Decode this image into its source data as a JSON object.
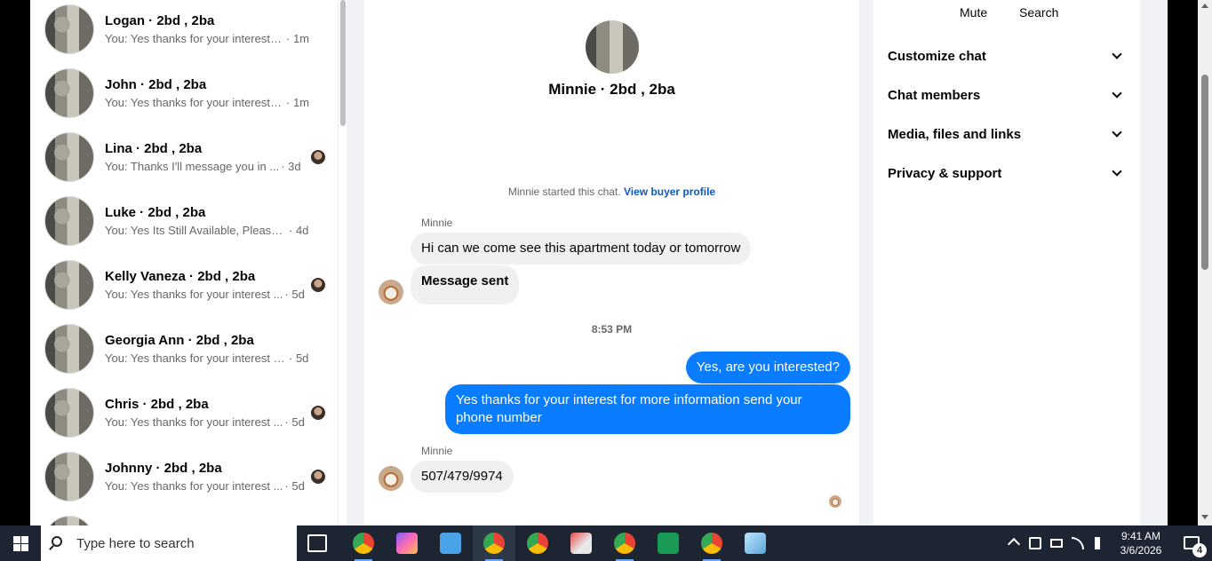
{
  "conversations": [
    {
      "name": "Logan · 2bd , 2ba",
      "preview": "You: Yes thanks for your interest fo...",
      "time": "· 1m",
      "read_avatar": false
    },
    {
      "name": "John · 2bd , 2ba",
      "preview": "You: Yes thanks for your interest fo...",
      "time": "· 1m",
      "read_avatar": false
    },
    {
      "name": "Lina · 2bd , 2ba",
      "preview": "You: Thanks I'll message you in ...",
      "time": "· 3d",
      "read_avatar": true
    },
    {
      "name": "Luke · 2bd , 2ba",
      "preview": "You: Yes Its Still Available, Please Se...",
      "time": "· 4d",
      "read_avatar": false
    },
    {
      "name": "Kelly Vaneza · 2bd , 2ba",
      "preview": "You: Yes thanks for your interest ...",
      "time": "· 5d",
      "read_avatar": true
    },
    {
      "name": "Georgia Ann · 2bd , 2ba",
      "preview": "You: Yes thanks for your interest for...",
      "time": "· 5d",
      "read_avatar": false
    },
    {
      "name": "Chris · 2bd , 2ba",
      "preview": "You: Yes thanks for your interest ...",
      "time": "· 5d",
      "read_avatar": true
    },
    {
      "name": "Johnny · 2bd , 2ba",
      "preview": "You: Yes thanks for your interest ...",
      "time": "· 5d",
      "read_avatar": true
    }
  ],
  "chat": {
    "title": "Minnie · 2bd , 2ba",
    "started_text": "Minnie started this chat.",
    "buyer_link": "View buyer profile",
    "sender_1": "Minnie",
    "msg_1": "Hi can we come see this apartment today or tomorrow",
    "msg_2": "Message sent",
    "timestamp": "8:53 PM",
    "msg_3": "Yes, are you interested?",
    "msg_4": "Yes thanks for your interest for more information send your phone number",
    "sender_2": "Minnie",
    "msg_5": "507/479/9974"
  },
  "info": {
    "mute": "Mute",
    "search": "Search",
    "sections": [
      "Customize chat",
      "Chat members",
      "Media, files and links",
      "Privacy & support"
    ]
  },
  "taskbar": {
    "search_placeholder": "Type here to search",
    "time": "9:41 AM",
    "date": "3/6/2026",
    "notification_count": "4"
  },
  "colors": {
    "accent_blue": "#0a7cff",
    "link_blue": "#0a58ca",
    "taskbar": "#1c2531"
  }
}
